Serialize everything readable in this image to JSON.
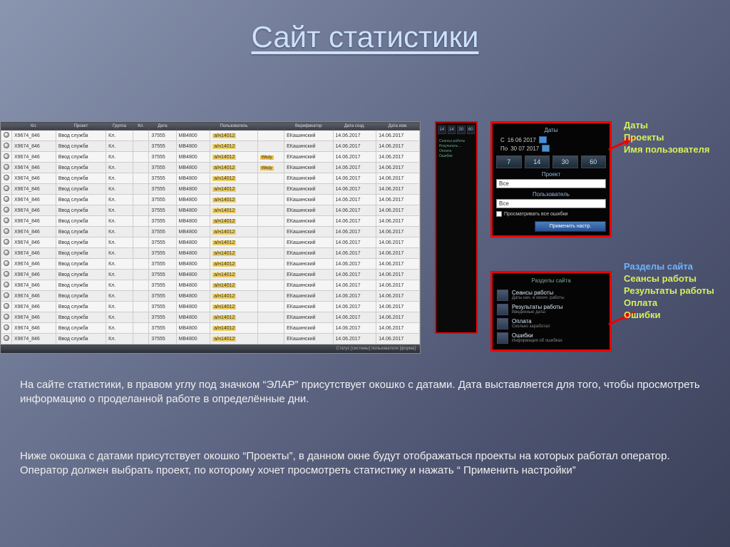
{
  "title": "Сайт статистики",
  "table": {
    "headers": [
      "",
      "Кл.",
      "Проект",
      "Группа",
      "Кл.",
      "Дата",
      "",
      "Пользователь",
      "",
      "Верификатор",
      "Дата созд.",
      "Дата изм."
    ],
    "row": {
      "project": "Х9674_846",
      "group": "Ввод служба",
      "kl": "Кл.",
      "code": "37555",
      "user": "МВ4800",
      "code2": "а/н14012",
      "wkdy": "Wkdy",
      "ver": "ЕКашинский",
      "date1": "14.06.2017",
      "date2": "14.06.2017"
    },
    "status": "Статус [системы] пользователя   [форма]"
  },
  "mid_boxes": [
    "14",
    "14",
    "30",
    "60"
  ],
  "filter": {
    "heading": "Даты",
    "from_label": "С",
    "from_date": "16 06 2017",
    "to_label": "По",
    "to_date": "30 07 2017",
    "periods": [
      "7",
      "14",
      "30",
      "60"
    ],
    "project_label": "Проект",
    "project_value": "Все",
    "user_label": "Пользователь",
    "user_value": "Все",
    "checkbox": "Просматривать все ошибки",
    "apply": "Применить настр."
  },
  "sections": {
    "title": "Разделы сайта",
    "items": [
      {
        "main": "Сеансы работы",
        "sub": "Даты нач. и оконч. работы"
      },
      {
        "main": "Результаты работы",
        "sub": "Введенные даты"
      },
      {
        "main": "Оплата",
        "sub": "Сколько заработал"
      },
      {
        "main": "Ошибки",
        "sub": "Информация об ошибках"
      }
    ]
  },
  "annot1": {
    "l1": "Даты",
    "l2": "Проекты",
    "l3": "Имя пользователя"
  },
  "annot2": {
    "l0": "Разделы сайта",
    "l1": "Сеансы работы",
    "l2": "Результаты работы",
    "l3": "Оплата",
    "l4": "Ошибки"
  },
  "para1": "На сайте статистики, в правом углу под значком “ЭЛАР”  присутствует окошко с датами. Дата выставляется для того, чтобы просмотреть информацию о проделанной работе в определённые дни.",
  "para2": "Ниже окошка с датами присутствует окошко “Проекты”, в данном окне будут отображаться проекты на которых работал оператор. Оператор должен  выбрать проект, по которому хочет просмотреть статистику и нажать “ Применить настройки”"
}
